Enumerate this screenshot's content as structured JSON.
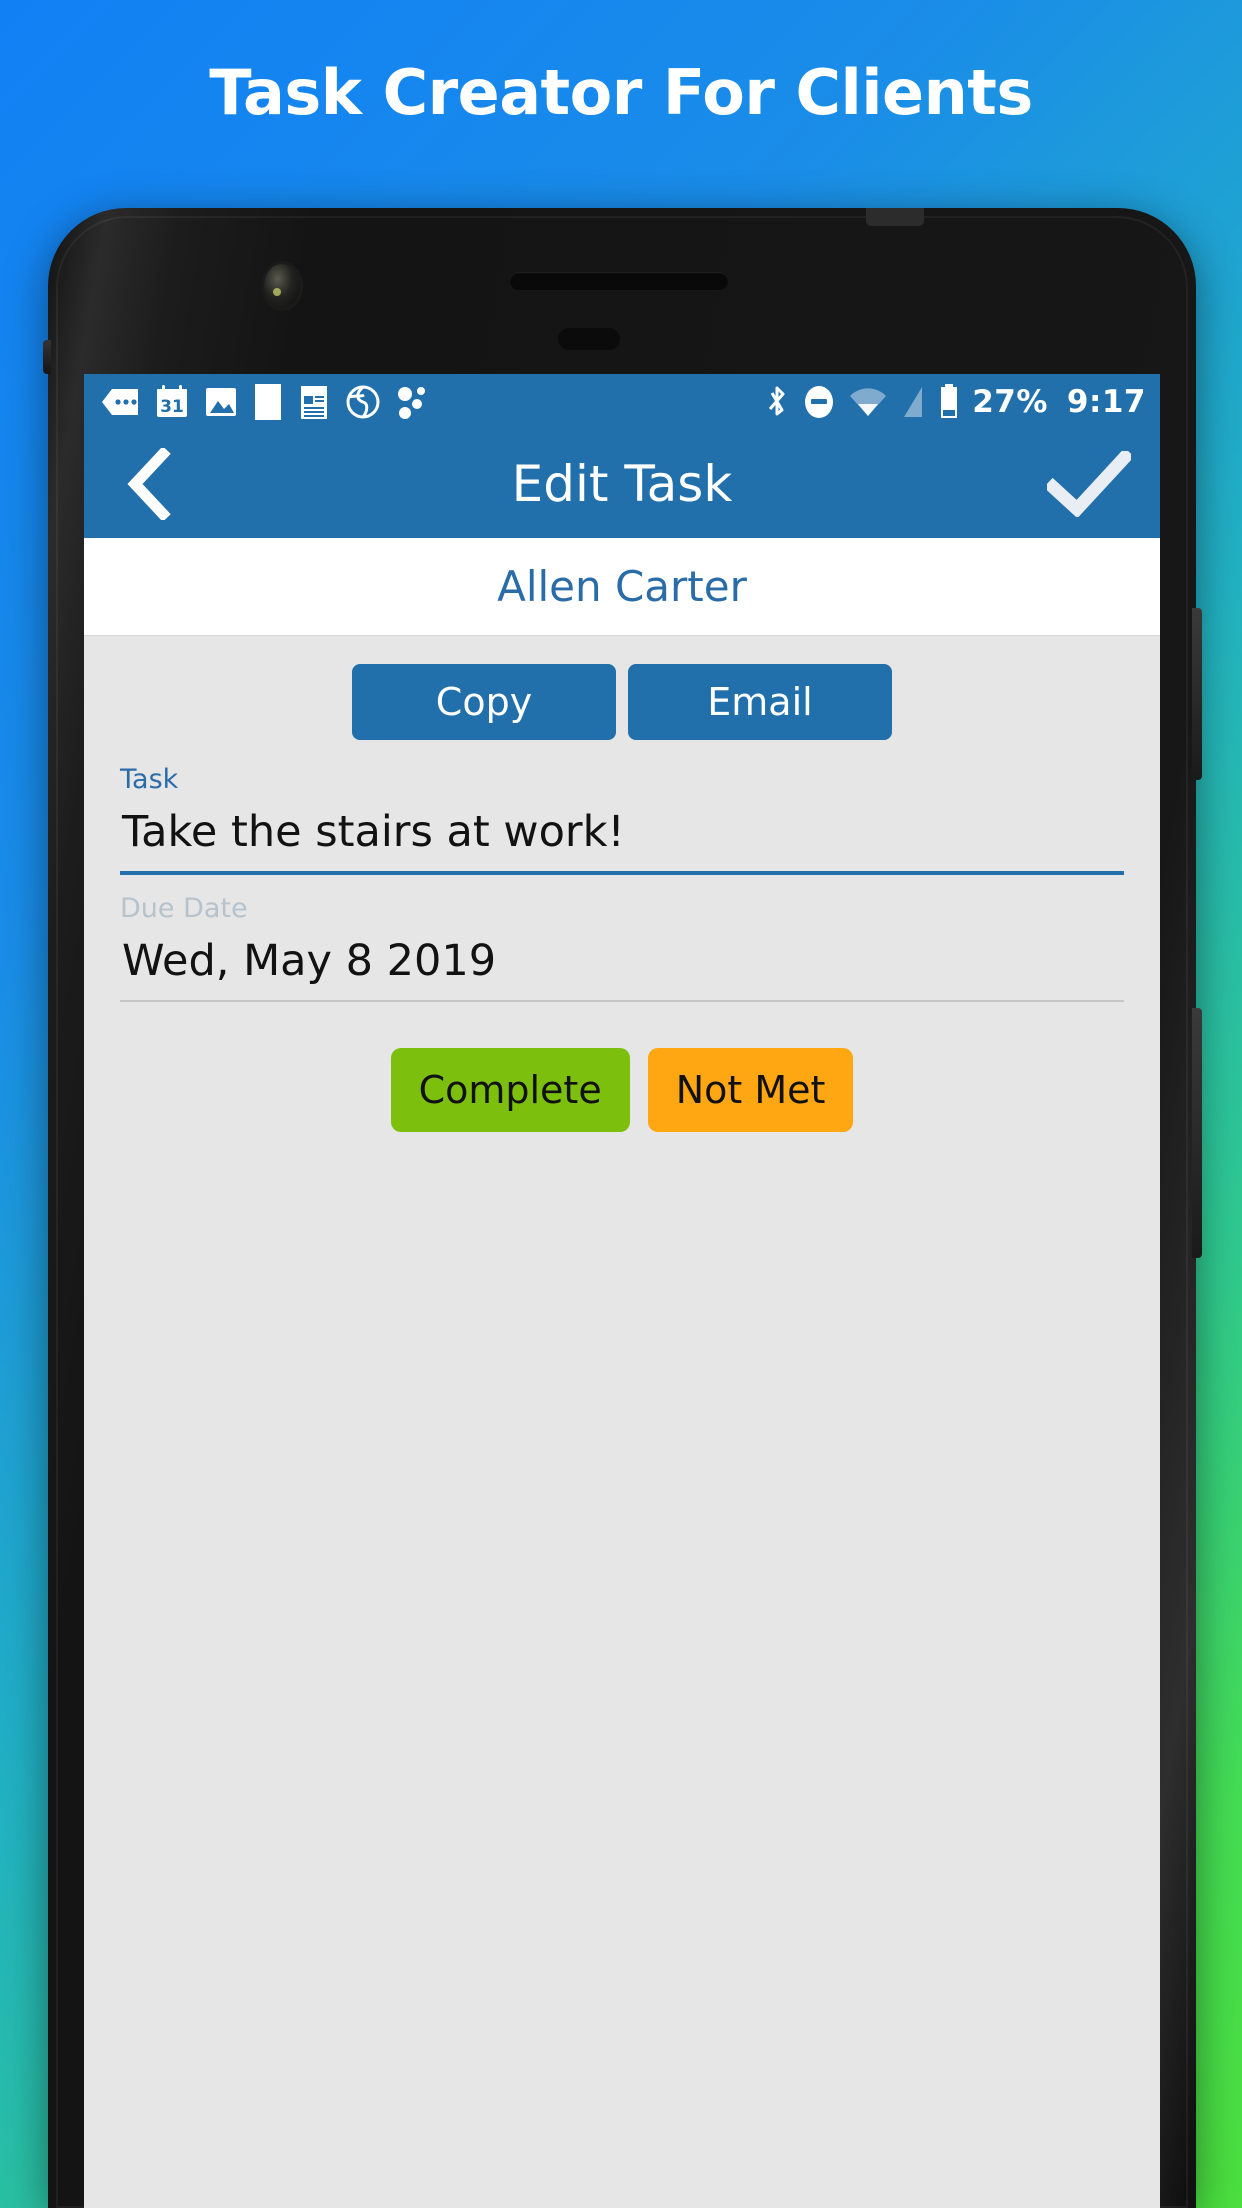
{
  "promo": {
    "headline": "Task Creator For Clients"
  },
  "phone": {
    "status_bar": {
      "icons": [
        "more-dots-icon",
        "calendar-31-icon",
        "photo-icon",
        "blank-page-icon",
        "notepad-icon",
        "globe-icon",
        "dots-scatter-icon",
        "bluetooth-icon",
        "do-not-disturb-icon",
        "wifi-icon",
        "cell-signal-icon",
        "battery-icon"
      ],
      "battery_percent": "27%",
      "time": "9:17"
    },
    "app_bar": {
      "back_icon": "chevron-left-icon",
      "title": "Edit Task",
      "confirm_icon": "check-icon"
    },
    "client": {
      "name": "Allen Carter"
    },
    "actions": {
      "copy_label": "Copy",
      "email_label": "Email"
    },
    "fields": {
      "task": {
        "label": "Task",
        "value": "Take the stairs at work!"
      },
      "due_date": {
        "label": "Due Date",
        "value": "Wed, May 8 2019"
      }
    },
    "status_actions": {
      "complete_label": "Complete",
      "not_met_label": "Not Met"
    }
  },
  "colors": {
    "brand_blue": "#216fab",
    "accent_green": "#7cc00d",
    "accent_orange": "#ffa713",
    "screen_bg": "#e6e6e6",
    "bg_gradient_start": "#1180f5",
    "bg_gradient_end": "#4ce03e"
  }
}
